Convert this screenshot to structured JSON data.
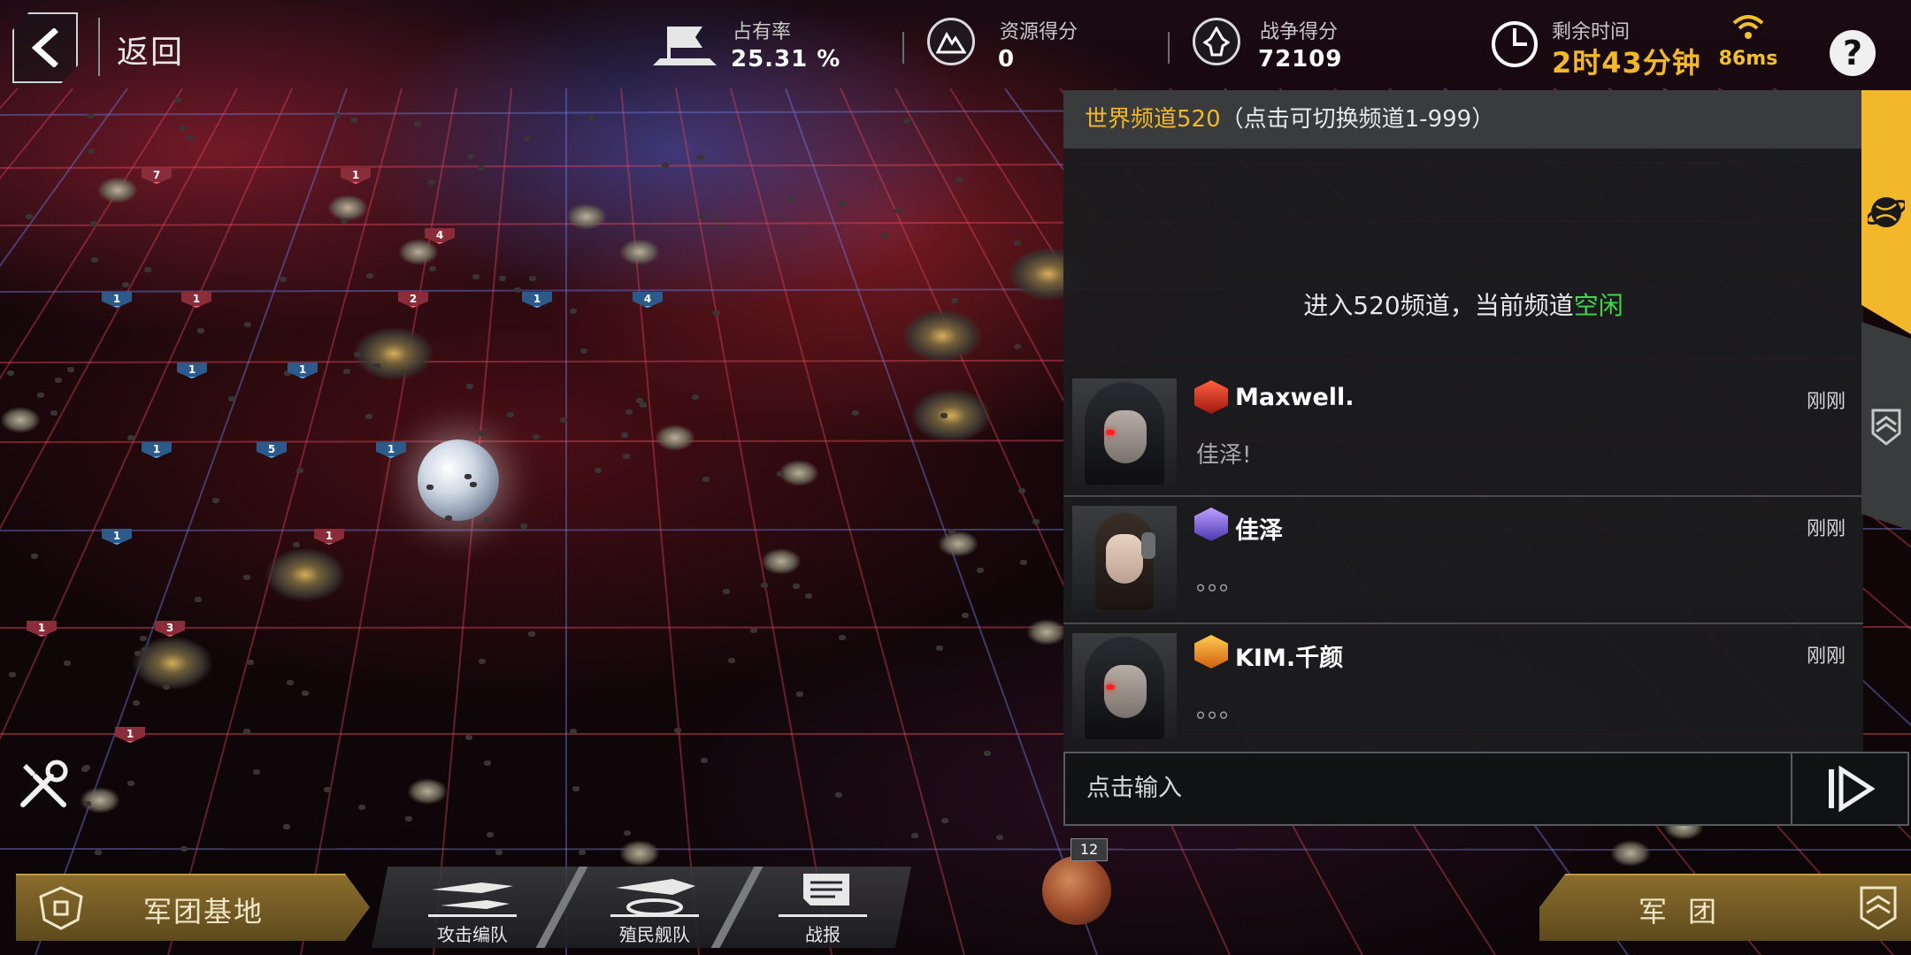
{
  "topbar": {
    "back_label": "返回",
    "occupancy": {
      "label": "占有率",
      "value": "25.31 %"
    },
    "resource_score": {
      "label": "资源得分",
      "value": "0"
    },
    "war_score": {
      "label": "战争得分",
      "value": "72109"
    },
    "remaining_time": {
      "label": "剩余时间",
      "value": "2时43分钟"
    },
    "ping": "86ms",
    "help_label": "?"
  },
  "map": {
    "badges": [
      {
        "text": "7",
        "color": "red"
      },
      {
        "text": "1",
        "color": "red"
      },
      {
        "text": "4",
        "color": "red"
      },
      {
        "text": "1",
        "color": "blue"
      },
      {
        "text": "1",
        "color": "red"
      },
      {
        "text": "2",
        "color": "red"
      },
      {
        "text": "1",
        "color": "blue"
      },
      {
        "text": "4",
        "color": "blue"
      },
      {
        "text": "1",
        "color": "blue"
      },
      {
        "text": "1",
        "color": "blue"
      },
      {
        "text": "1",
        "color": "blue"
      },
      {
        "text": "5",
        "color": "blue"
      },
      {
        "text": "1",
        "color": "blue"
      },
      {
        "text": "1",
        "color": "blue"
      },
      {
        "text": "1",
        "color": "red"
      },
      {
        "text": "1",
        "color": "red"
      },
      {
        "text": "3",
        "color": "red"
      },
      {
        "text": "1",
        "color": "red"
      }
    ],
    "mars_badge": "12"
  },
  "chat": {
    "header_channel": "世界频道520",
    "header_hint": "（点击可切换频道1-999）",
    "system_prefix": "进入520频道，当前频道",
    "system_status": "空闲",
    "messages": [
      {
        "name": "Maxwell.",
        "time": "刚刚",
        "text": "佳泽!",
        "rank": "red"
      },
      {
        "name": "佳泽",
        "time": "刚刚",
        "text": "。。。",
        "rank": "purple"
      },
      {
        "name": "KIM.千颜",
        "time": "刚刚",
        "text": "。。。",
        "rank": "orange"
      }
    ],
    "input_placeholder": "点击输入"
  },
  "bottombar": {
    "base_label": "军团基地",
    "fleet": [
      {
        "label": "攻击编队"
      },
      {
        "label": "殖民舰队"
      },
      {
        "label": "战报"
      }
    ],
    "legion_label": "军团"
  },
  "colors": {
    "accent_gold": "#f2b82a",
    "idle_green": "#3ed84a",
    "badge_blue": "#5ab0ff",
    "badge_red": "#ff6070"
  }
}
